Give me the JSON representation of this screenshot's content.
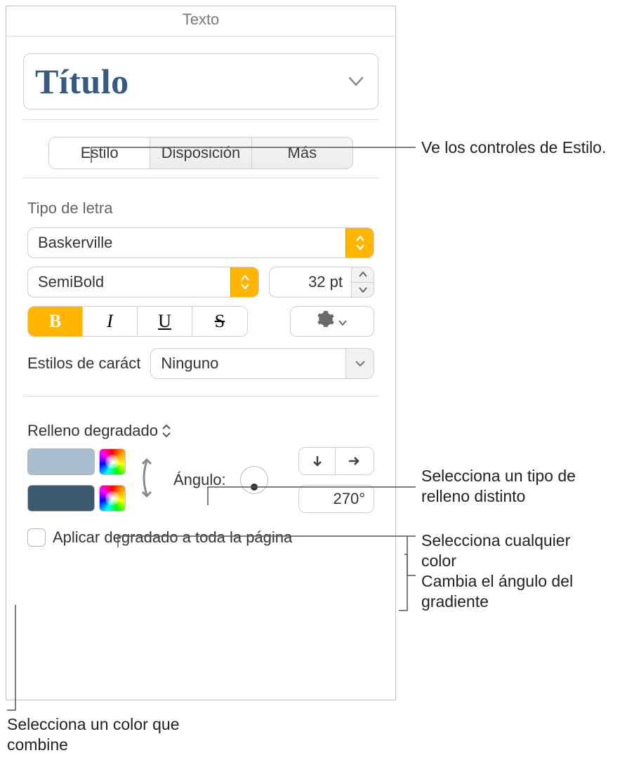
{
  "panel": {
    "title": "Texto"
  },
  "preset": {
    "label": "Título"
  },
  "tabs": {
    "style": "Estilo",
    "layout": "Disposición",
    "more": "Más"
  },
  "font": {
    "section": "Tipo de letra",
    "family": "Baskerville",
    "weight": "SemiBold",
    "size": "32 pt",
    "charstyles_label": "Estilos de caráct",
    "charstyles_value": "Ninguno"
  },
  "fill": {
    "type": "Relleno degradado",
    "angle_label": "Ángulo:",
    "angle_value": "270°",
    "color_start": "#A9BFCF",
    "color_end": "#3B5A6E",
    "apply_page": "Aplicar degradado a toda la página"
  },
  "callouts": {
    "style": "Ve los controles de Estilo.",
    "filltype": "Selecciona un tipo de relleno distinto",
    "anycolor": "Selecciona cualquier color",
    "angle": "Cambia el ángulo del gradiente",
    "matchcolor": "Selecciona un color que combine"
  }
}
